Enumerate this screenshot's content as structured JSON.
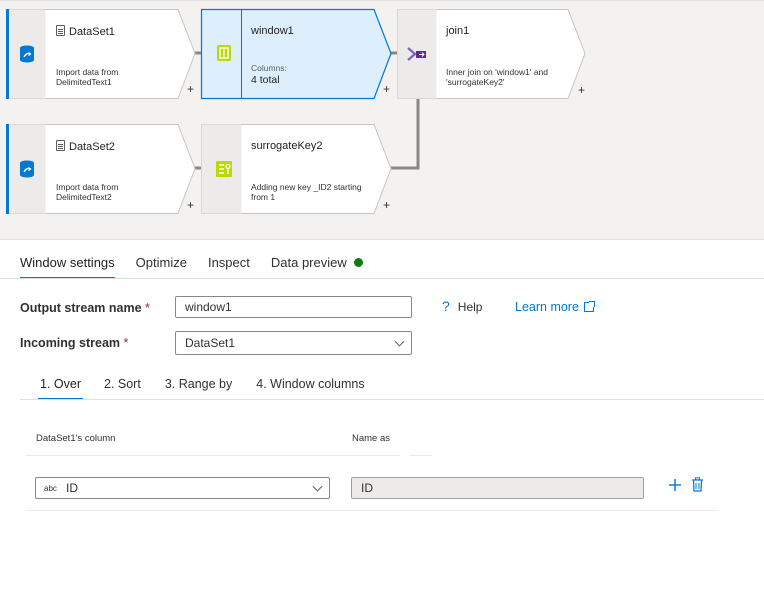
{
  "nodes": {
    "dataset1": {
      "title": "DataSet1",
      "desc": "Import data from DelimitedText1"
    },
    "window1": {
      "title": "window1",
      "columns_label": "Columns:",
      "columns_value": "4 total"
    },
    "join1": {
      "title": "join1",
      "desc": "Inner join on 'window1' and 'surrogateKey2'"
    },
    "dataset2": {
      "title": "DataSet2",
      "desc": "Import data from DelimitedText2"
    },
    "surrogatekey2": {
      "title": "surrogateKey2",
      "desc": "Adding new key _ID2 starting from 1"
    },
    "add_symbol": "+"
  },
  "tabs": [
    "Window settings",
    "Optimize",
    "Inspect",
    "Data preview"
  ],
  "form": {
    "output_stream_label": "Output stream name",
    "output_stream_value": "window1",
    "incoming_stream_label": "Incoming stream",
    "incoming_stream_value": "DataSet1",
    "required_mark": "*",
    "help_label": "Help",
    "help_symbol": "?",
    "learn_more": "Learn more"
  },
  "subtabs": [
    "1. Over",
    "2. Sort",
    "3. Range by",
    "4. Window columns"
  ],
  "over_table": {
    "col_header": "DataSet1's column",
    "name_header": "Name as",
    "type_badge": "abc",
    "column_value": "ID",
    "name_value": "ID"
  },
  "colors": {
    "accent": "#0078d4",
    "selected_node": "#ddeefc",
    "status_green": "#107c10",
    "source_bar": "#0078d4"
  }
}
